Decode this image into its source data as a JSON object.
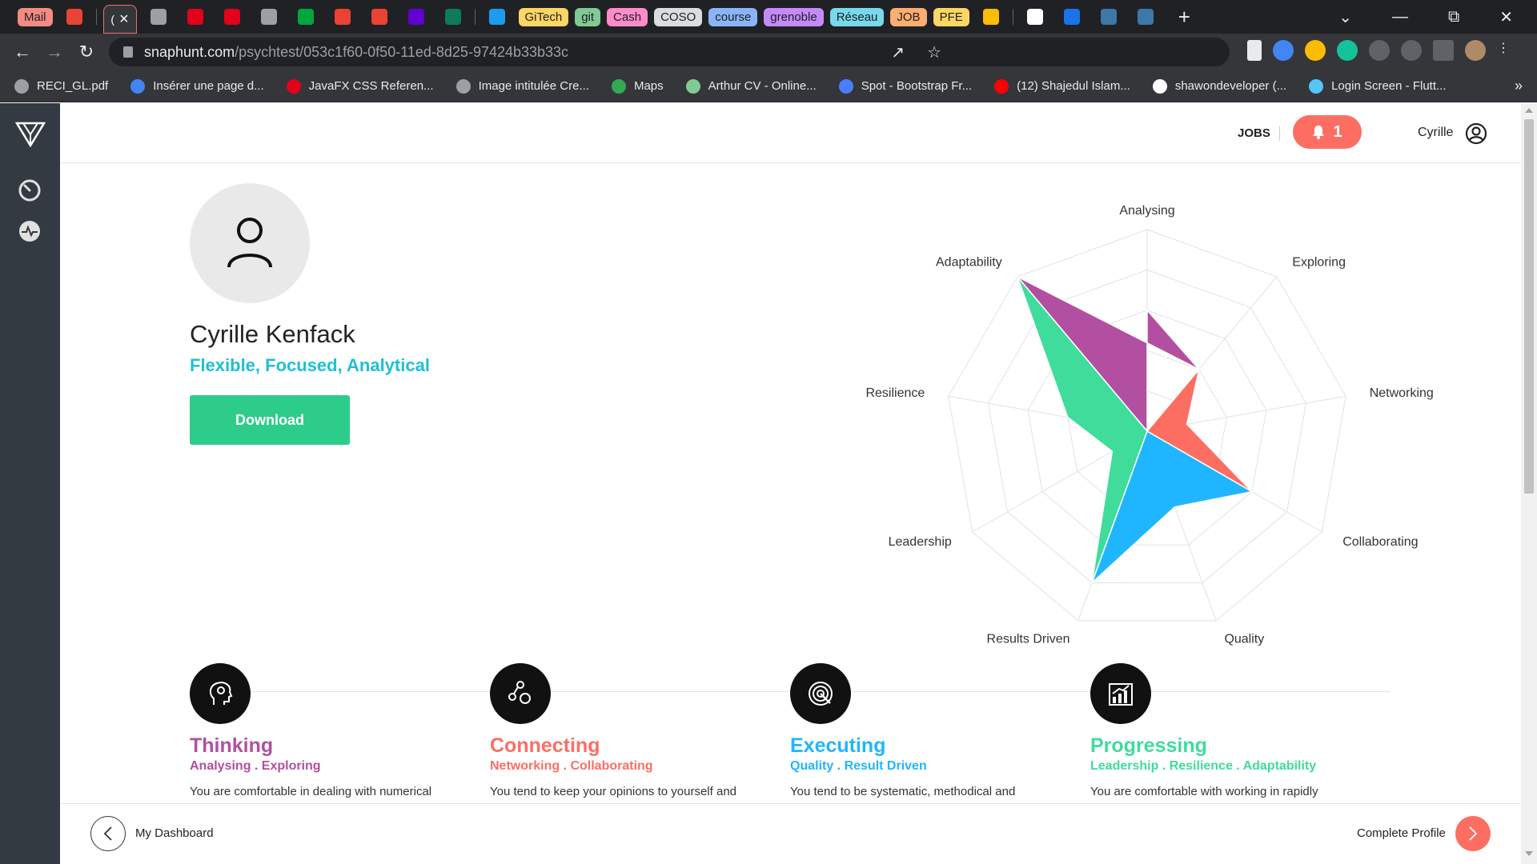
{
  "browser": {
    "tabs": [
      {
        "label": "Mail",
        "color": "#f28b82",
        "kind": "chip"
      },
      {
        "icon": "gmail-icon",
        "color": "#ea4335"
      },
      {
        "label": "(",
        "kind": "active"
      },
      {
        "icon": "globe-icon",
        "color": "#9aa0a6"
      },
      {
        "icon": "acrobat-icon",
        "color": "#e3001b"
      },
      {
        "icon": "acrobat-icon",
        "color": "#e3001b"
      },
      {
        "icon": "globe-icon",
        "color": "#9aa0a6"
      },
      {
        "icon": "chat-icon",
        "color": "#00a63e"
      },
      {
        "icon": "gmail-icon",
        "color": "#ea4335"
      },
      {
        "icon": "gmail-icon",
        "color": "#ea4335"
      },
      {
        "icon": "mail-icon",
        "color": "#6001d2"
      },
      {
        "icon": "c-icon",
        "color": "#0f7a5a"
      },
      {
        "icon": "twitter-icon",
        "color": "#1d9bf0"
      },
      {
        "label": "GiTech",
        "color": "#fdd663",
        "kind": "chip"
      },
      {
        "label": "git",
        "color": "#81c995",
        "kind": "chip"
      },
      {
        "label": "Cash",
        "color": "#ff8bcb",
        "kind": "chip"
      },
      {
        "label": "COSO",
        "color": "#dadce0",
        "kind": "chip"
      },
      {
        "label": "course",
        "color": "#8ab4f8",
        "kind": "chip"
      },
      {
        "label": "grenoble",
        "color": "#c58af9",
        "kind": "chip"
      },
      {
        "label": "Réseau",
        "color": "#78d9ec",
        "kind": "chip"
      },
      {
        "label": "JOB",
        "color": "#fcad70",
        "kind": "chip"
      },
      {
        "label": "PFE",
        "color": "#fdd663",
        "kind": "chip"
      },
      {
        "icon": "drive-icon",
        "color": "#fbbc04"
      },
      {
        "icon": "google-icon",
        "color": "#ffffff"
      },
      {
        "icon": "blue-dot-icon",
        "color": "#1a73e8"
      },
      {
        "icon": "vscode-icon",
        "color": "#3c78a8"
      },
      {
        "icon": "vscode-icon",
        "color": "#3c78a8"
      }
    ],
    "url_host": "snaphunt.com",
    "url_path": "/psychtest/053c1f60-0f50-11ed-8d25-97424b33b33c",
    "bookmarks": [
      {
        "label": "RECI_GL.pdf",
        "color": "#9aa0a6"
      },
      {
        "label": "Insérer une page d...",
        "color": "#4285f4"
      },
      {
        "label": "JavaFX CSS Referen...",
        "color": "#e3001b"
      },
      {
        "label": "Image intitulée Cre...",
        "color": "#9aa0a6"
      },
      {
        "label": "Maps",
        "color": "#34a853"
      },
      {
        "label": "Arthur CV - Online...",
        "color": "#81c995"
      },
      {
        "label": "Spot - Bootstrap Fr...",
        "color": "#4a7dff"
      },
      {
        "label": "(12) Shajedul Islam...",
        "color": "#ff0000"
      },
      {
        "label": "shawondeveloper (...",
        "color": "#ffffff"
      },
      {
        "label": "Login Screen - Flutt...",
        "color": "#54c5f8"
      }
    ]
  },
  "header": {
    "jobs": "JOBS",
    "notifications": "1",
    "user": "Cyrille"
  },
  "profile": {
    "name": "Cyrille Kenfack",
    "traits": "Flexible, Focused, Analytical",
    "download": "Download"
  },
  "chart_data": {
    "type": "radar",
    "axes": [
      "Analysing",
      "Exploring",
      "Networking",
      "Collaborating",
      "Quality",
      "Results Driven",
      "Leadership",
      "Resilience",
      "Adaptability"
    ],
    "max": 5,
    "grid": true,
    "series": [
      {
        "group": "Thinking",
        "color": "#b34fa0",
        "values": {
          "Adaptability": 5,
          "Analysing": 3,
          "Exploring": 2
        }
      },
      {
        "group": "Connecting",
        "color": "#fd6e62",
        "values": {
          "Exploring": 2,
          "Networking": 1,
          "Collaborating": 3
        }
      },
      {
        "group": "Executing",
        "color": "#1fb6ff",
        "values": {
          "Collaborating": 3,
          "Quality": 2,
          "Results Driven": 4
        }
      },
      {
        "group": "Progressing",
        "color": "#3fdc9c",
        "values": {
          "Results Driven": 4,
          "Leadership": 1,
          "Resilience": 2,
          "Adaptability": 5
        }
      }
    ]
  },
  "categories": [
    {
      "title": "Thinking",
      "sub": "Analysing . Exploring",
      "desc": "You are comfortable in dealing with numerical",
      "color": "#b34fa0"
    },
    {
      "title": "Connecting",
      "sub": "Networking . Collaborating",
      "desc": "You tend to keep your opinions to yourself and",
      "color": "#fd6e62"
    },
    {
      "title": "Executing",
      "sub": "Quality . Result Driven",
      "desc": "You tend to be systematic, methodical and",
      "color": "#1fb6ff"
    },
    {
      "title": "Progressing",
      "sub": "Leadership . Resilience . Adaptability",
      "desc": "You are comfortable with working in rapidly",
      "color": "#3fdc9c"
    }
  ],
  "footer": {
    "left": "My Dashboard",
    "right": "Complete Profile"
  }
}
